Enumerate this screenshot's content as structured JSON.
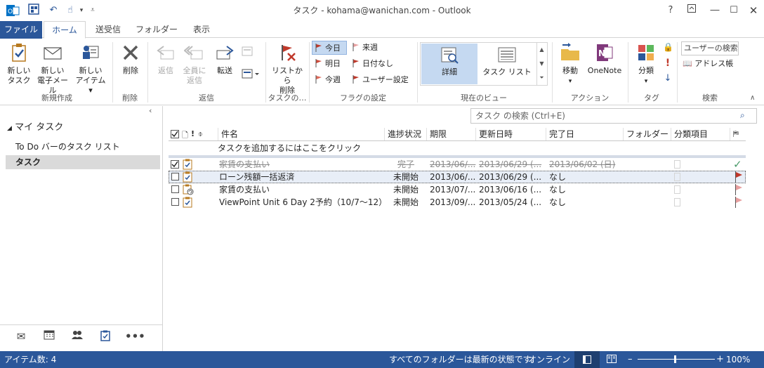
{
  "window": {
    "title": "タスク - kohama@wanichan.com - Outlook",
    "help": "?",
    "buttons": [
      "restore",
      "minimize",
      "maximize",
      "close"
    ]
  },
  "tabs": [
    "ファイル",
    "ホーム",
    "送受信",
    "フォルダー",
    "表示"
  ],
  "ribbon": {
    "new_group": {
      "label": "新規作成",
      "new_task": "新しい\nタスク",
      "new_task_l1": "新しい",
      "new_task_l2": "タスク",
      "new_email_l1": "新しい",
      "new_email_l2": "電子メール",
      "new_items_l1": "新しい",
      "new_items_l2": "アイテム"
    },
    "delete_group": {
      "label": "削除",
      "delete": "削除"
    },
    "reply_group": {
      "label": "返信",
      "reply": "返信",
      "reply_all_l1": "全員に",
      "reply_all_l2": "返信",
      "forward": "転送"
    },
    "task_group": {
      "label": "タスクの…",
      "remove_l1": "リストから",
      "remove_l2": "削除"
    },
    "flag_group": {
      "label": "フラグの設定",
      "today": "今日",
      "tomorrow": "明日",
      "this_week": "今週",
      "next_week": "来週",
      "no_date": "日付なし",
      "custom": "ユーザー設定"
    },
    "view_group": {
      "label": "現在のビュー",
      "detail": "詳細",
      "task_list": "タスク リスト"
    },
    "action_group": {
      "label": "アクション",
      "move": "移動",
      "onenote": "OneNote"
    },
    "tags_group": {
      "label": "タグ",
      "categorize": "分類"
    },
    "search_group": {
      "label": "検索",
      "search_people": "ユーザーの検索",
      "address_book": "アドレス帳"
    }
  },
  "sidebar": {
    "header": "マイ タスク",
    "items": [
      {
        "label": "To Do バーのタスク リスト",
        "selected": false
      },
      {
        "label": "タスク",
        "selected": true
      }
    ]
  },
  "search": {
    "placeholder": "タスク の検索 (Ctrl+E)"
  },
  "table": {
    "columns": [
      "件名",
      "進捗状況",
      "期限",
      "更新日時",
      "完了日",
      "フォルダー",
      "分類項目"
    ],
    "add_row": "タスクを追加するにはここをクリック",
    "rows": [
      {
        "subject": "家賃の支払い",
        "status": "完了",
        "due": "2013/06/...",
        "modified": "2013/06/29 (...",
        "completed": "2013/06/02 (日)",
        "done": true,
        "flag": "check"
      },
      {
        "subject": "ローン残額一括返済",
        "status": "未開始",
        "due": "2013/06/...",
        "modified": "2013/06/29 (...",
        "completed": "なし",
        "done": false,
        "flag": "red"
      },
      {
        "subject": "家賃の支払い",
        "status": "未開始",
        "due": "2013/07/...",
        "modified": "2013/06/16 (...",
        "completed": "なし",
        "done": false,
        "flag": "pink"
      },
      {
        "subject": "ViewPoint Unit 6 Day 2予約（10/7〜12）",
        "status": "未開始",
        "due": "2013/09/...",
        "modified": "2013/05/24 (...",
        "completed": "なし",
        "done": false,
        "flag": "pink"
      }
    ]
  },
  "status": {
    "items": "アイテム数: 4",
    "sync": "すべてのフォルダーは最新の状態です。",
    "connection": "オンライン",
    "zoom": "100%"
  },
  "colors": {
    "accent": "#2b579a",
    "flag_red": "#c0392b",
    "flag_pink": "#e8a0a0",
    "check": "#4a9a6a"
  }
}
